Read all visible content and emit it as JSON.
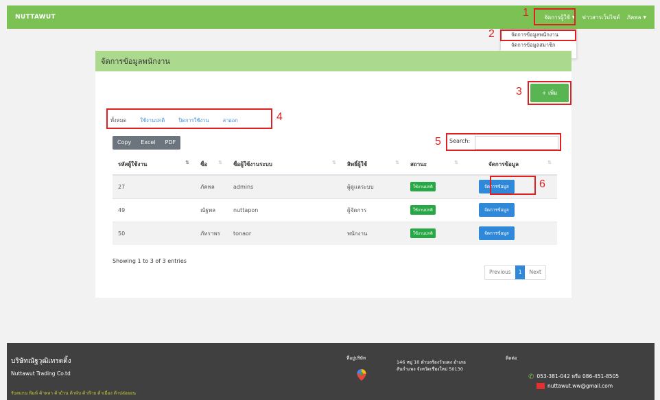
{
  "navbar": {
    "brand": "NUTTAWUT",
    "menu_user": "จัดการผู้ใช้",
    "menu_news": "ข่าวสารเว็บไซต์",
    "menu_account": "ภัคพล",
    "accent": "#7cc154"
  },
  "dropdown": {
    "items": [
      "จัดการข้อมูลพนักงาน",
      "จัดการข้อมูลสมาชิก"
    ]
  },
  "markers": [
    "1",
    "2",
    "3",
    "4",
    "5",
    "6"
  ],
  "card": {
    "title": "จัดการข้อมูลพนักงาน",
    "add_button": "+ เพิ่ม"
  },
  "tabs": [
    "ทั้งหมด",
    "ใช้งานปกติ",
    "ปิดการใช้งาน",
    "ลาออก"
  ],
  "export_buttons": [
    "Copy",
    "Excel",
    "PDF"
  ],
  "search_label": "Search:",
  "table": {
    "headers": [
      "รหัสผู้ใช้งาน",
      "ชื่อ",
      "ชื่อผู้ใช้งานระบบ",
      "สิทธิ์ผู้ใช้",
      "สถานะ",
      "จัดการข้อมูล"
    ],
    "rows": [
      {
        "id": "27",
        "name": "ภัคพล",
        "username": "admins",
        "role": "ผู้ดูแลระบบ",
        "status": "ใช้งานปกติ",
        "action": "จัดการข้อมูล"
      },
      {
        "id": "49",
        "name": "ณัฐพล",
        "username": "nuttapon",
        "role": "ผู้จัดการ",
        "status": "ใช้งานปกติ",
        "action": "จัดการข้อมูล"
      },
      {
        "id": "50",
        "name": "ภัทราพร",
        "username": "tonaor",
        "role": "พนักงาน",
        "status": "ใช้งานปกติ",
        "action": "จัดการข้อมูล"
      }
    ]
  },
  "showing": "Showing 1 to 3 of 3 entries",
  "pagination": {
    "previous": "Previous",
    "current": "1",
    "next": "Next"
  },
  "footer": {
    "company_th": "บริษัทณัฐวุฒิเทรดดิ้ง",
    "company_en": "Nuttawut Trading Co.td",
    "services": "รับสแกน พิมพ์ ค้าหลา ค้าม้วน ค้าพับ ค้าฟ้าย ค้าเมือง ค้าปล่อยอน",
    "office_label": "ที่อยู่บริษัท",
    "address_line1": "146 หมู่ 10 ตำบลร้องวัวแดง อำเภอ",
    "address_line2": "สันกำแพง จังหวัดเชียงใหม่ 50130",
    "contact_label": "ติดต่อ",
    "phone": "053-381-042 หรือ 086-451-8505",
    "email": "nuttawut.ww@gmail.com"
  }
}
